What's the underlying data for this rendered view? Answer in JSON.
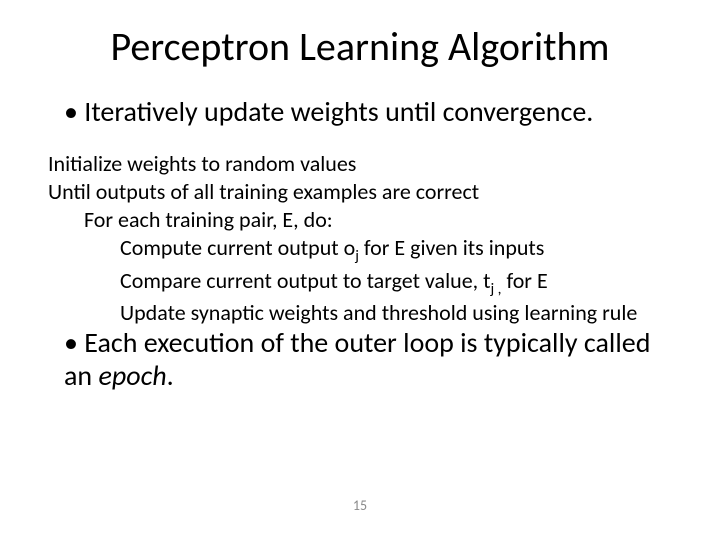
{
  "title": "Perceptron Learning Algorithm",
  "bullet_top": "Iteratively update weights until convergence.",
  "algo": {
    "l0a": "Initialize weights to random values",
    "l0b": "Until outputs of all training examples are correct",
    "l1a": "For each training pair, E, do:",
    "l2a_pre": "Compute current output o",
    "l2a_sub": "j",
    "l2a_post": " for E given its inputs",
    "l2b_pre": "Compare current output to target value, t",
    "l2b_sub": "j ,",
    "l2b_post": " for E",
    "l2c": "Update synaptic weights and threshold using learning rule"
  },
  "bullet_body_pre": "Each execution of the outer loop is typically called an ",
  "bullet_body_em": "epoch",
  "bullet_body_post": ".",
  "page_number": "15"
}
